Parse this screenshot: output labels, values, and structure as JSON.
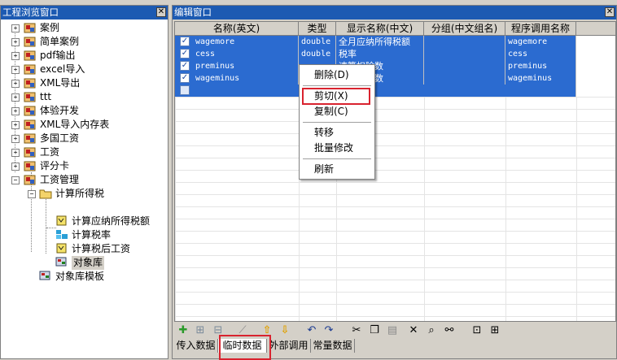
{
  "left_window": {
    "title": "工程浏览窗口",
    "tree": [
      {
        "label": "案例"
      },
      {
        "label": "简单案例"
      },
      {
        "label": "pdf输出"
      },
      {
        "label": "excel导入"
      },
      {
        "label": "XML导出"
      },
      {
        "label": "ttt"
      },
      {
        "label": "体验开发"
      },
      {
        "label": "XML导入内存表"
      },
      {
        "label": "多国工资"
      },
      {
        "label": "工资"
      },
      {
        "label": "评分卡"
      },
      {
        "label": "工资管理"
      },
      {
        "label": "计算所得税"
      },
      {
        "label": "计算应纳所得税额"
      },
      {
        "label": "计算税率"
      },
      {
        "label": "计算税后工资"
      },
      {
        "label": "对象库"
      },
      {
        "label": "对象库模板"
      }
    ]
  },
  "right_window": {
    "title": "编辑窗口",
    "columns": [
      "名称(英文)",
      "类型",
      "显示名称(中文)",
      "分组(中文组名)",
      "程序调用名称"
    ],
    "rows": [
      {
        "name": "wagemore",
        "type": "double",
        "display": "全月应纳所得税额",
        "group": "",
        "call": "wagemore"
      },
      {
        "name": "cess",
        "type": "double",
        "display": "税率",
        "group": "",
        "call": "cess"
      },
      {
        "name": "preminus",
        "type": "",
        "display": "速算扣除数",
        "group": "",
        "call": "preminus"
      },
      {
        "name": "wageminus",
        "type": "",
        "display": "工资扣除数",
        "group": "",
        "call": "wageminus"
      }
    ],
    "tabs": [
      "传入数据",
      "临时数据",
      "外部调用",
      "常量数据"
    ],
    "active_tab": "临时数据"
  },
  "context_menu": {
    "items": [
      {
        "label": "删除(D)"
      },
      {
        "label": "剪切(X)"
      },
      {
        "label": "复制(C)"
      },
      {
        "label": "转移"
      },
      {
        "label": "批量修改"
      },
      {
        "label": "刷新"
      }
    ]
  },
  "colors": {
    "title_bar": "#1c5ab2",
    "selection": "#2b6bd0",
    "highlight_box": "#d9232f"
  },
  "icons": {
    "toolbar": [
      "add-icon",
      "add-child-icon",
      "add-sibling-icon",
      "wand-icon",
      "move-up-icon",
      "move-down-icon",
      "undo-icon",
      "redo-icon",
      "cut-icon",
      "copy-icon",
      "paste-icon",
      "delete-icon",
      "find-icon",
      "binoculars-icon",
      "import-icon",
      "export-icon"
    ]
  }
}
